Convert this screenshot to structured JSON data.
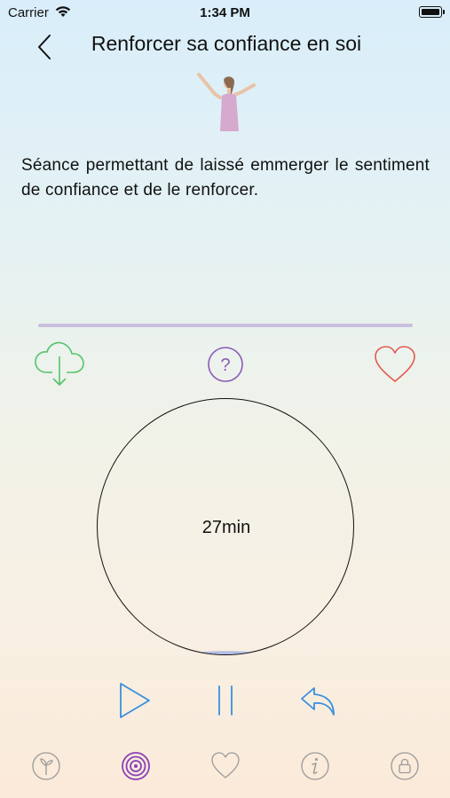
{
  "status_bar": {
    "carrier": "Carrier",
    "time": "1:34 PM"
  },
  "nav": {
    "title": "Renforcer sa confiance en soi"
  },
  "session": {
    "description": "Séance permettant de laissé emmerger le sentiment de confiance et de le renforcer.",
    "duration": "27min",
    "progress_fraction": 0
  },
  "colors": {
    "cloud": "#55c46a",
    "help": "#8a5bb8",
    "heart": "#e4584f",
    "controls": "#3a8fe0",
    "tab_active": "#8a3fb8",
    "tab_inactive": "#9a9a9a"
  },
  "actions": {
    "download_icon": "cloud-download-icon",
    "help_icon": "question-circle-icon",
    "favorite_icon": "heart-icon"
  },
  "player": {
    "play_icon": "play-icon",
    "pause_icon": "pause-icon",
    "replay_icon": "replay-icon"
  },
  "tabbar": {
    "items": [
      {
        "icon": "sprout-icon",
        "active": false
      },
      {
        "icon": "target-icon",
        "active": true
      },
      {
        "icon": "heart-icon",
        "active": false
      },
      {
        "icon": "info-icon",
        "active": false
      },
      {
        "icon": "lock-icon",
        "active": false
      }
    ]
  }
}
